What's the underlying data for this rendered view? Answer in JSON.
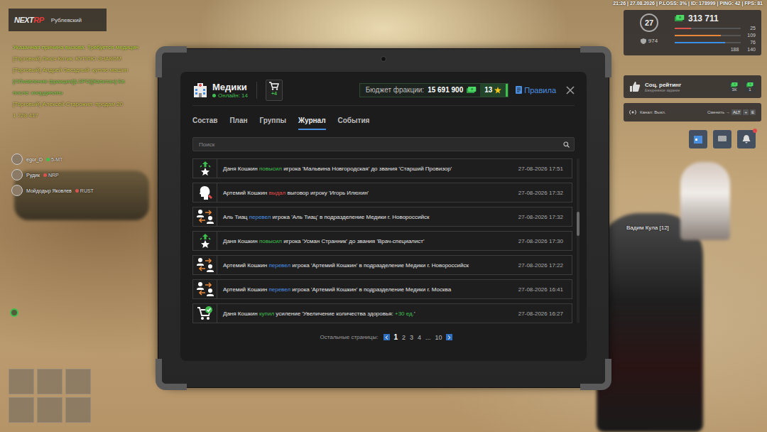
{
  "status_bar": "21:26 | 27.08.2026 | P.LOSS: 3% | ID: 178999 | PING: 42 | FPS: 81",
  "logo": {
    "left": "NEXT",
    "right": "RP"
  },
  "location": {
    "district": "Рублевский"
  },
  "chat": [
    {
      "text": "Указанная причина вызова: Требуется медицин",
      "color": "#b7d63c"
    },
    {
      "text": "[Торговый] Люся Котик: КУПЛЮ ЗНАКОМ",
      "color": "#c9c24a"
    },
    {
      "text": "[Торговый] Андрей Звездный: куплю машин",
      "color": "#c9c24a"
    },
    {
      "text": "[Объявление фракции][LSPD][Капитан] Ев",
      "color": "#7fc94a"
    },
    {
      "text": "после: координаты",
      "color": "#7fc94a"
    },
    {
      "text": "[Торговый] Алексей Старожил: продам 20",
      "color": "#c9c24a"
    },
    {
      "text": "1 728 417",
      "color": "#c9c24a"
    }
  ],
  "voice": [
    {
      "name": "egor_D",
      "tag": "5-МТ",
      "color": "#3fbf4f"
    },
    {
      "name": "Рудик",
      "tag": "NRP",
      "color": "#d9534f"
    },
    {
      "name": "Мойдодыр Яковлев",
      "tag": "RUST",
      "color": "#d9534f"
    }
  ],
  "hud": {
    "level": "27",
    "money": "313 711",
    "armor": "974",
    "stats": [
      {
        "value": "25",
        "level": 0.25,
        "color": "#d9534f"
      },
      {
        "value": "109",
        "level": 0.7,
        "color": "#e8873a"
      },
      {
        "value": "76",
        "level": 0.76,
        "color": "#3a8fe8"
      }
    ],
    "extras": [
      "188",
      "140"
    ]
  },
  "social": {
    "title": "Соц. рейтинг",
    "subtitle": "Ежедневное задание",
    "rewards": [
      "3К",
      "1"
    ]
  },
  "channel": {
    "label": "Канал: Выкл.",
    "hint": "Сменить →",
    "keys": [
      "ALT",
      "+",
      "E"
    ]
  },
  "nameplate": "Вадим Кула [12]",
  "tablet": {
    "title": "Медики",
    "online": "Онлайн: 14",
    "cart_badge": "+4",
    "budget": {
      "label": "Бюджет фракции:",
      "amount": "15 691 900",
      "stars": "13"
    },
    "rules": "Правила",
    "tabs": [
      {
        "label": "Состав",
        "selected": false
      },
      {
        "label": "План",
        "selected": false
      },
      {
        "label": "Группы",
        "selected": false
      },
      {
        "label": "Журнал",
        "selected": true
      },
      {
        "label": "События",
        "selected": false
      }
    ],
    "search": {
      "placeholder": "Поиск"
    },
    "rows": [
      {
        "kind": "promote",
        "time": "27-08-2026 17:51",
        "parts": [
          {
            "text": "Даня Кошкин ",
            "color": "#e6e6e6"
          },
          {
            "text": "повысил",
            "color": "#3fbf4f"
          },
          {
            "text": " игрока 'Мальвина Новгородская' до звания 'Старший Провизор'",
            "color": "#e6e6e6"
          }
        ]
      },
      {
        "kind": "reprimand",
        "time": "27-08-2026 17:32",
        "parts": [
          {
            "text": "Артемий Кошкин ",
            "color": "#e6e6e6"
          },
          {
            "text": "выдал",
            "color": "#e04a4a"
          },
          {
            "text": " выговор игроку 'Игорь Илюхин'",
            "color": "#e6e6e6"
          }
        ]
      },
      {
        "kind": "transfer",
        "time": "27-08-2026 17:32",
        "parts": [
          {
            "text": "Аль Тиац ",
            "color": "#e6e6e6"
          },
          {
            "text": "перевел",
            "color": "#4a8fe0"
          },
          {
            "text": " игрока 'Аль Тиац' в подразделение Медики г. Новороссийск",
            "color": "#e6e6e6"
          }
        ]
      },
      {
        "kind": "promote",
        "time": "27-08-2026 17:30",
        "parts": [
          {
            "text": "Даня Кошкин ",
            "color": "#e6e6e6"
          },
          {
            "text": "повысил",
            "color": "#3fbf4f"
          },
          {
            "text": " игрока 'Усман Странник' до звания 'Врач-специалист'",
            "color": "#e6e6e6"
          }
        ]
      },
      {
        "kind": "transfer",
        "time": "27-08-2026 17:22",
        "parts": [
          {
            "text": "Артемий Кошкин ",
            "color": "#e6e6e6"
          },
          {
            "text": "перевел",
            "color": "#4a8fe0"
          },
          {
            "text": " игрока 'Артемий Кошкин' в подразделение Медики г. Новороссийск",
            "color": "#e6e6e6"
          }
        ]
      },
      {
        "kind": "transfer",
        "time": "27-08-2026 16:41",
        "parts": [
          {
            "text": "Артемий Кошкин ",
            "color": "#e6e6e6"
          },
          {
            "text": "перевел",
            "color": "#4a8fe0"
          },
          {
            "text": " игрока 'Артемий Кошкин' в подразделение Медики г. Москва",
            "color": "#e6e6e6"
          }
        ]
      },
      {
        "kind": "purchase",
        "time": "27-08-2026 16:27",
        "parts": [
          {
            "text": "Даня Кошкин ",
            "color": "#e6e6e6"
          },
          {
            "text": "купил",
            "color": "#3fbf4f"
          },
          {
            "text": " усиление 'Увеличение количества здоровья: ",
            "color": "#e6e6e6"
          },
          {
            "text": "+30 ед.",
            "color": "#3fbf4f"
          },
          {
            "text": "'",
            "color": "#e6e6e6"
          }
        ]
      }
    ],
    "scroll": {
      "level": 0.38
    },
    "pagination": {
      "label": "Остальные страницы:",
      "pages": [
        {
          "text": "1",
          "selected": true
        },
        {
          "text": "2",
          "selected": false
        },
        {
          "text": "3",
          "selected": false
        },
        {
          "text": "4",
          "selected": false
        },
        {
          "text": "...",
          "selected": false
        },
        {
          "text": "10",
          "selected": false
        }
      ]
    }
  }
}
